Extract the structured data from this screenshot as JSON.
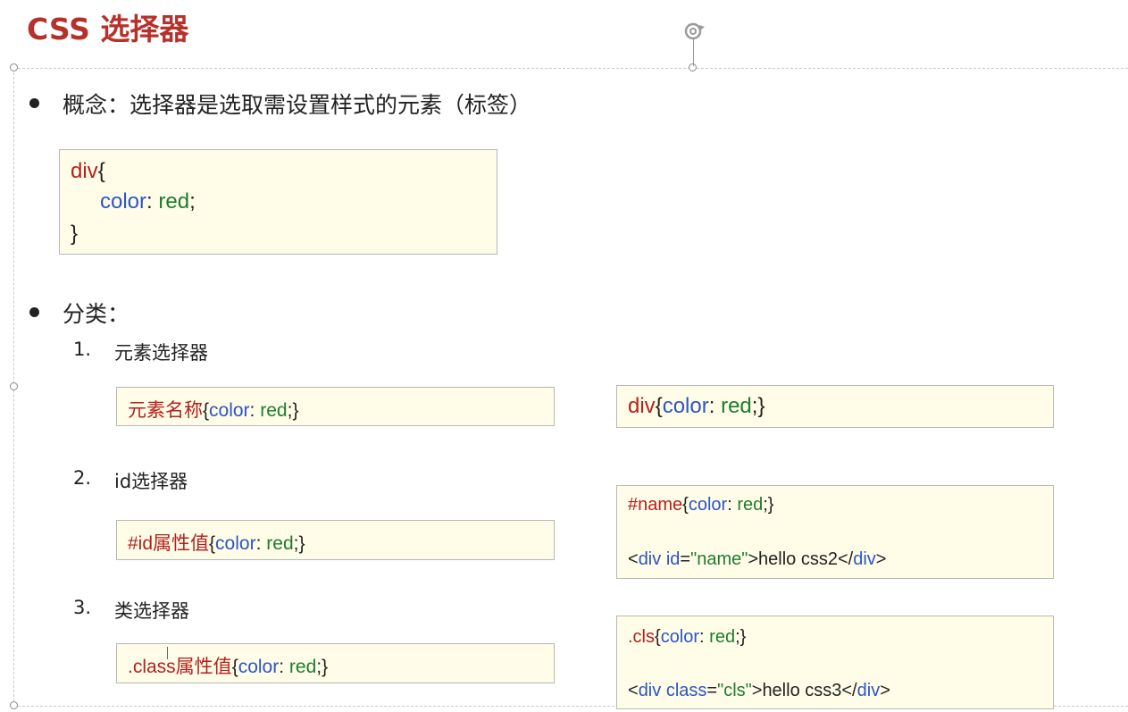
{
  "slide": {
    "title": "CSS 选择器",
    "concept_text": "概念：选择器是选取需设置样式的元素（标签）",
    "classify_text": "分类：",
    "items": [
      {
        "number": "1.",
        "label": "元素选择器"
      },
      {
        "number": "2.",
        "label": "id选择器"
      },
      {
        "number": "3.",
        "label": "类选择器"
      }
    ]
  },
  "code": {
    "main": {
      "selector": "div",
      "brace_open": "{",
      "prop": "color",
      "colon": ":",
      "value": "red",
      "semi": ";",
      "brace_close": "}"
    },
    "element_syntax": {
      "selector": "元素名称",
      "brace_open": "{",
      "prop": "color",
      "colon": ":",
      "value": "red",
      "semi": ";",
      "brace_close": "}"
    },
    "element_example": {
      "selector": "div",
      "brace_open": "{",
      "prop": "color",
      "colon": ":",
      "value": "red",
      "semi": ";",
      "brace_close": "}"
    },
    "id_syntax": {
      "selector": "#id属性值",
      "brace_open": "{",
      "prop": "color",
      "colon": ":",
      "value": "red",
      "semi": ";",
      "brace_close": "}"
    },
    "id_example": {
      "selector": "#name",
      "brace_open": "{",
      "prop": "color",
      "colon": ":",
      "value": "red",
      "semi": ";",
      "brace_close": "}",
      "html": {
        "lt": "<",
        "tag": "div",
        "attr": "id",
        "eq": "=",
        "attr_value": "\"name\"",
        "gt": ">",
        "content": "hello css2",
        "close_lt": "</",
        "close_tag": "div",
        "close_gt": ">"
      }
    },
    "class_syntax": {
      "selector": ".class属性值",
      "brace_open": "{",
      "prop": "color",
      "colon": ":",
      "value": "red",
      "semi": ";",
      "brace_close": "}"
    },
    "class_example": {
      "selector": ".cls",
      "brace_open": "{",
      "prop": "color",
      "colon": ":",
      "value": "red",
      "semi": ";",
      "brace_close": "}",
      "html": {
        "lt": "<",
        "tag": "div",
        "attr": "class",
        "eq": "=",
        "attr_value": "\"cls\"",
        "gt": ">",
        "content": "hello css3",
        "close_lt": "</",
        "close_tag": "div",
        "close_gt": ">"
      }
    }
  },
  "icons": {
    "rotate_handle": "rotate-icon"
  },
  "colors": {
    "title": "#b7312c",
    "selector": "#b4201d",
    "property": "#2d55c4",
    "value": "#1d7c2e",
    "box_bg": "#fffde8"
  }
}
